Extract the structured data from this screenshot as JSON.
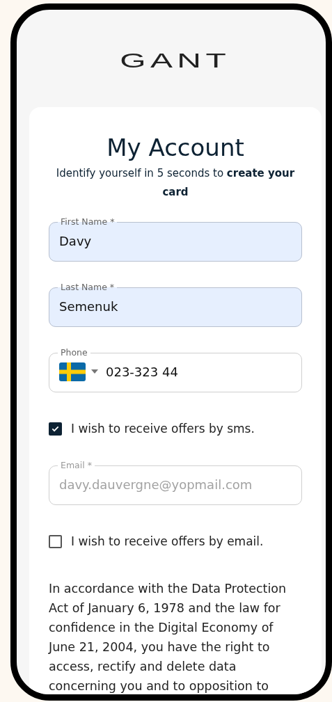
{
  "logo": {
    "text": "GANT"
  },
  "heading": {
    "title": "My Account",
    "subtitle": "Identify yourself in 5 seconds to **create your card**"
  },
  "fields": [
    {
      "kind": "text",
      "label": "First Name *",
      "value": "Davy",
      "autofilled": true,
      "disabled": false
    },
    {
      "kind": "text",
      "label": "Last Name *",
      "value": "Semenuk",
      "autofilled": true,
      "disabled": false
    },
    {
      "kind": "phone",
      "label": "Phone",
      "value": "023-323 44",
      "autofilled": false,
      "disabled": false
    },
    {
      "kind": "checkbox",
      "label": "I wish to receive offers by sms.",
      "checked": true
    },
    {
      "kind": "text",
      "label": "Email *",
      "value": "davy.dauvergne@yopmail.com",
      "autofilled": false,
      "disabled": true
    },
    {
      "kind": "checkbox",
      "label": "I wish to receive offers by email.",
      "checked": false
    }
  ],
  "notice": "In accordance with the Data Protection Act of January 6, 1978 and the law for confidence in the Digital Economy of June 21, 2004, you have the right to access, rectify and delete data concerning you and to opposition to"
}
